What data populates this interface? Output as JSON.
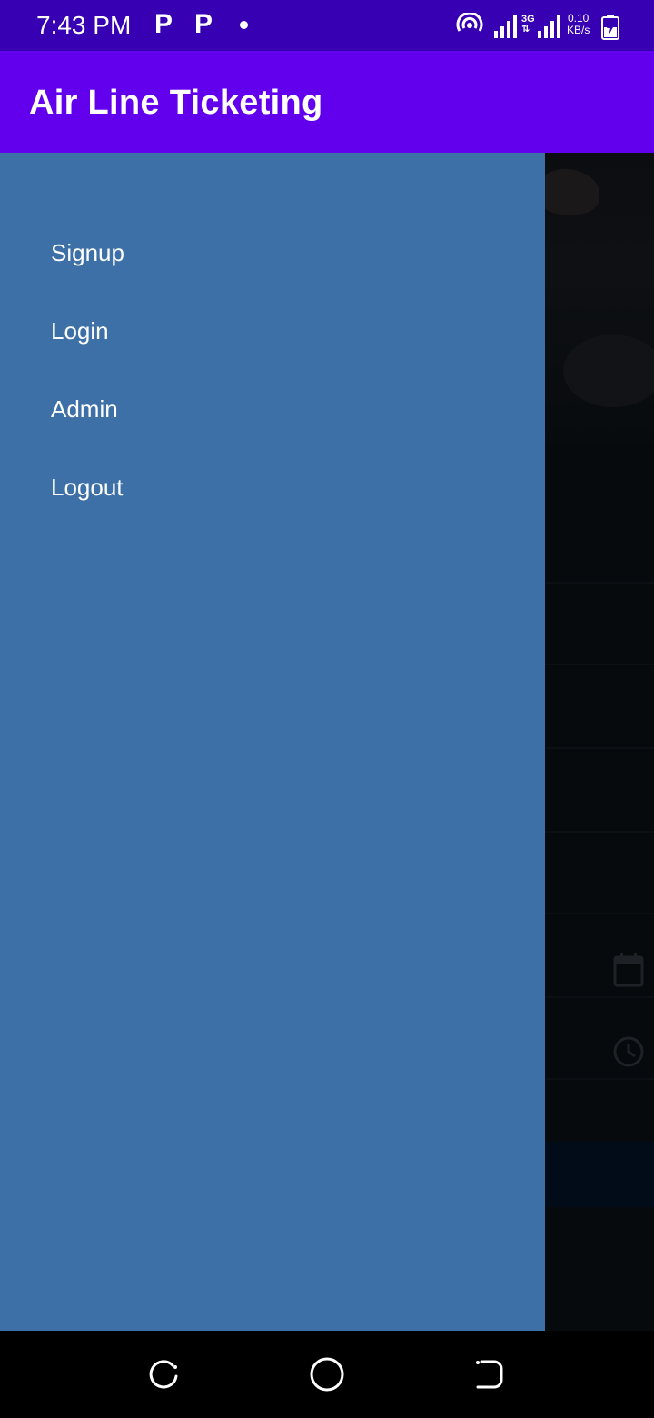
{
  "status_bar": {
    "time": "7:43 PM",
    "notification_icons": [
      "p-icon",
      "p-icon",
      "dot-icon"
    ],
    "network_type": "3G",
    "network_arrows": "⇅",
    "speed_value": "0.10",
    "speed_unit": "KB/s",
    "icons": [
      "hotspot-icon",
      "signal-icon",
      "signal-icon",
      "battery-charging-icon"
    ]
  },
  "app_bar": {
    "title": "Air Line Ticketing",
    "color": "#6200ee"
  },
  "drawer": {
    "background": "#3d70a6",
    "items": [
      {
        "label": "Signup"
      },
      {
        "label": "Login"
      },
      {
        "label": "Admin"
      },
      {
        "label": "Logout"
      }
    ]
  },
  "background_content": {
    "icons": [
      "calendar-icon",
      "clock-icon"
    ]
  },
  "nav_bar": {
    "buttons": [
      "recent-apps-icon",
      "home-icon",
      "back-icon"
    ]
  }
}
